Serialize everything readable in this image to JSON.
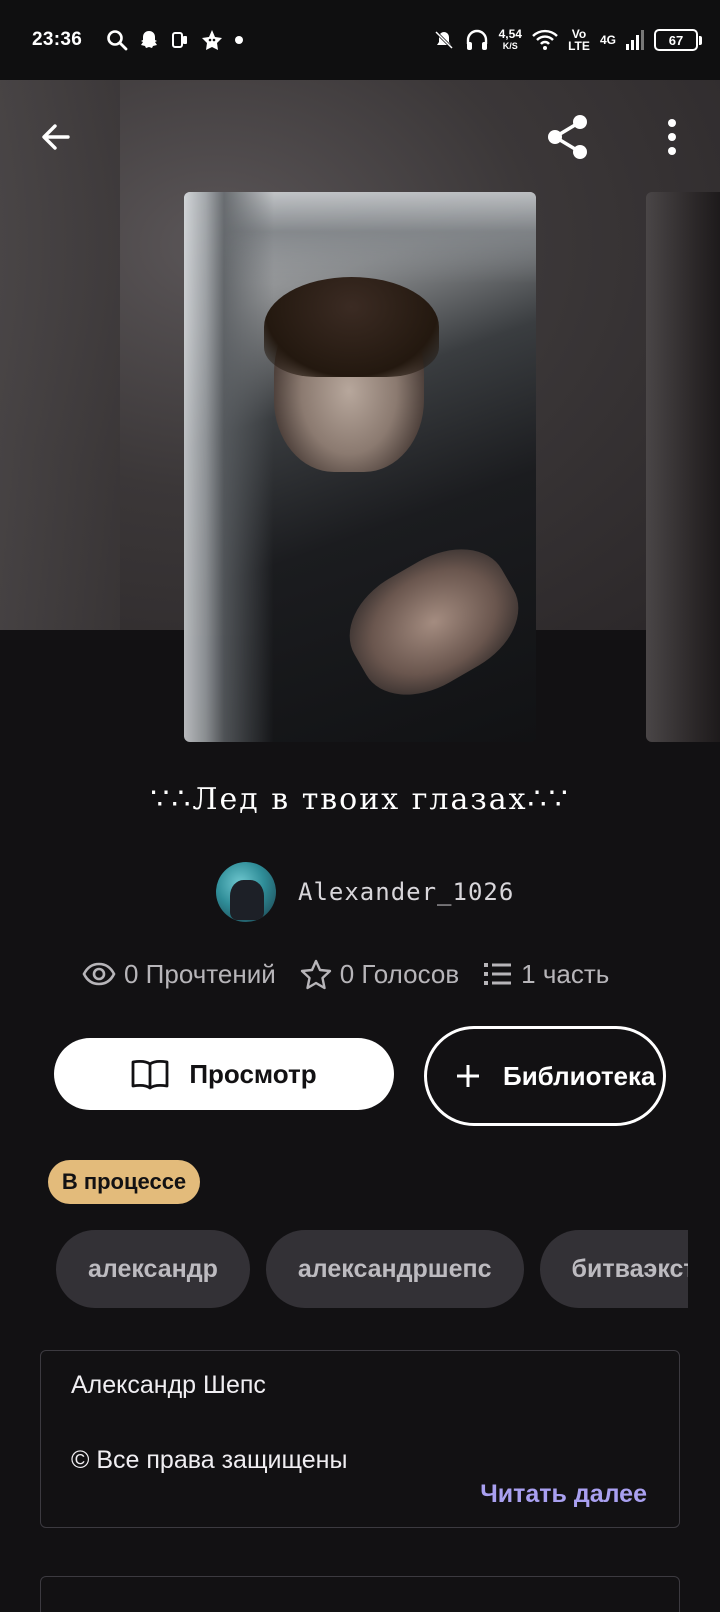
{
  "status_bar": {
    "time": "23:36",
    "net_speed": "4,54",
    "net_unit": "K/S",
    "volte": "Vo LTE",
    "signal": "4G",
    "battery": "67"
  },
  "story": {
    "title": "∵∴Лед в твоих глазах∴∵",
    "author": "Alexander_1026",
    "reads": "0 Прочтений",
    "votes": "0 Голосов",
    "parts": "1 часть",
    "view_button": "Просмотр",
    "library_button": "Библиотека",
    "status": "В процессе",
    "tags": [
      "александр",
      "александршепс",
      "битваэкстрасенсов"
    ],
    "description_line1": "Александр Шепс",
    "description_line2": "© Все права защищены",
    "read_more": "Читать далее"
  },
  "icons": {
    "back": "arrow-left-icon",
    "share": "share-icon",
    "more": "more-vertical-icon",
    "reads": "eye-icon",
    "votes": "star-icon",
    "parts": "list-icon",
    "view": "book-icon",
    "library": "plus-icon"
  },
  "colors": {
    "background": "#121113",
    "status_badge": "#e3bb7b",
    "accent_link": "#a9a0f0",
    "tag_bg": "#333136"
  }
}
